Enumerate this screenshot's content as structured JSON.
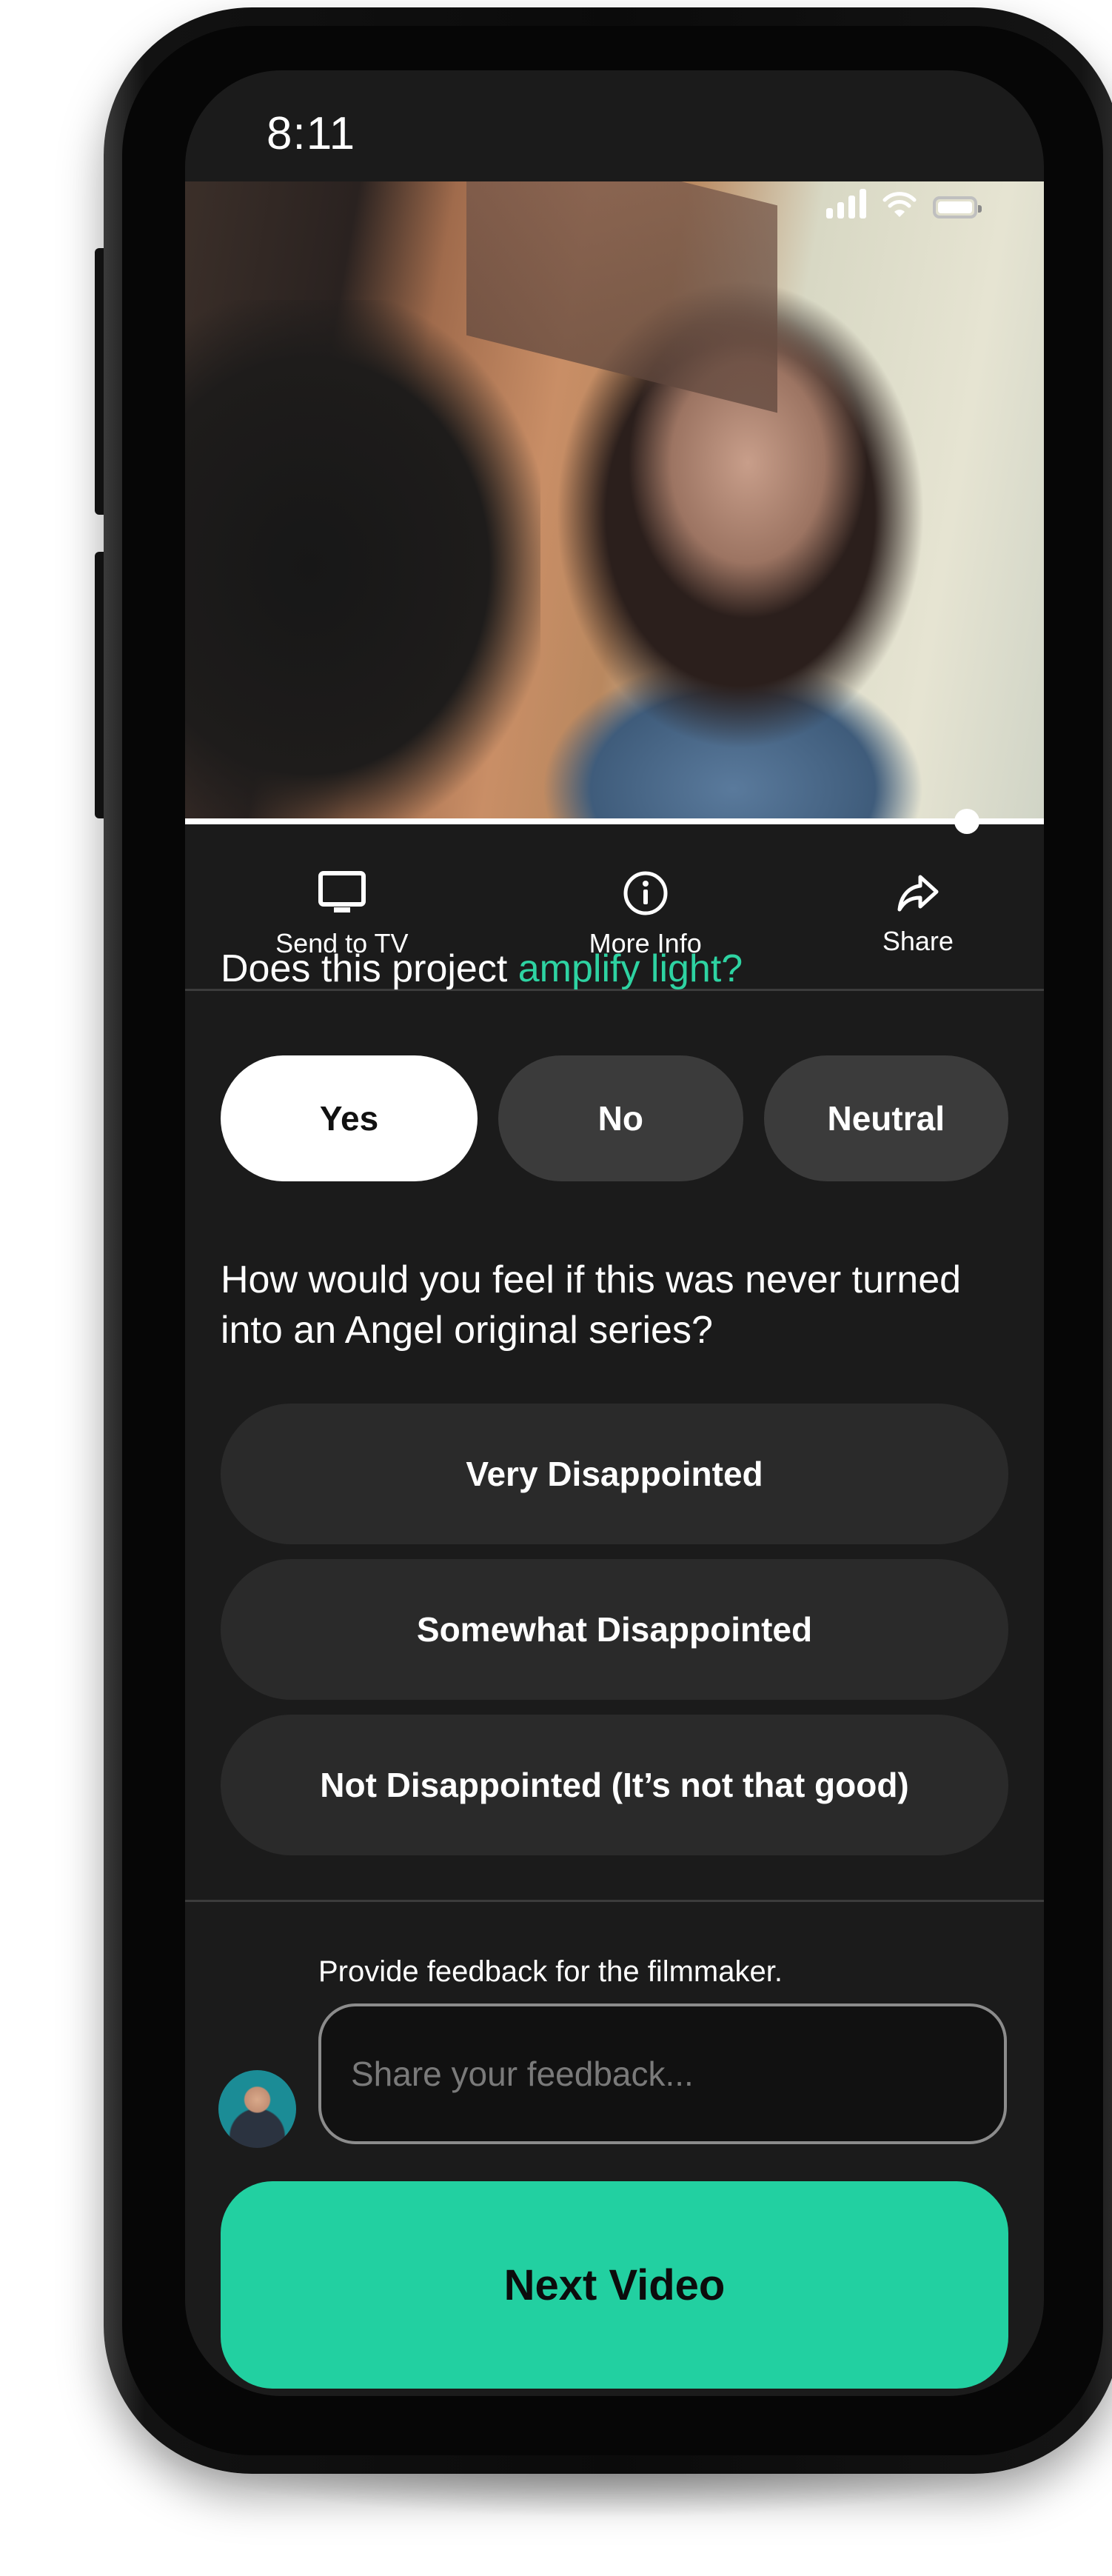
{
  "status_bar": {
    "time": "8:11",
    "icons": [
      "cellular-signal-icon",
      "wifi-icon",
      "battery-icon"
    ]
  },
  "video": {
    "description": "Paused video frame: woman with dark curly hair in blue dress beside wooden building",
    "progress_fraction": 0.91
  },
  "actions": [
    {
      "label": "Send to TV",
      "icon": "tv-icon"
    },
    {
      "label": "More Info",
      "icon": "info-icon"
    },
    {
      "label": "Share",
      "icon": "share-arrow-icon"
    }
  ],
  "question_1": {
    "prefix": "Does this project ",
    "highlight": "amplify light?",
    "options": [
      "Yes",
      "No",
      "Neutral"
    ],
    "selected": "Yes"
  },
  "question_2": {
    "text": "How would you feel if this was never turned into an Angel original series?",
    "options": [
      "Very Disappointed",
      "Somewhat Disappointed",
      "Not Disappointed (It’s not that good)"
    ]
  },
  "feedback": {
    "label": "Provide feedback for the filmmaker.",
    "placeholder": "Share your feedback...",
    "value": ""
  },
  "next_button": {
    "label": "Next Video"
  },
  "colors": {
    "accent": "#2ed3a2",
    "button": "#22d0a1",
    "screen_bg": "#1b1b1b",
    "pill_bg": "#3b3b3b",
    "option_bg": "#2a2a2a"
  }
}
